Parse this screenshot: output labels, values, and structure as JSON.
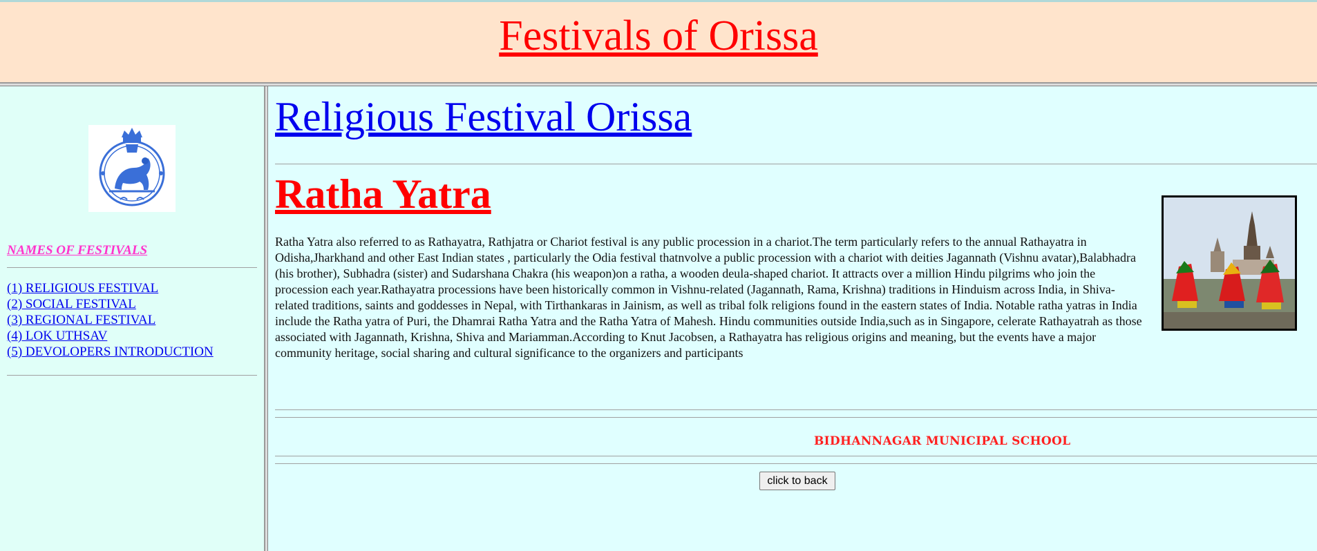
{
  "header": {
    "title": "Festivals of Orissa",
    "bg_color": "#ffe4cc",
    "title_color": "#ff0000"
  },
  "sidebar": {
    "emblem_icon": "odisha-state-emblem-icon",
    "heading": "NAMES OF FESTIVALS",
    "links": [
      {
        "label": "(1) RELIGIOUS FESTIVAL"
      },
      {
        "label": "(2) SOCIAL FESTIVAL"
      },
      {
        "label": "(3) REGIONAL FESTIVAL"
      },
      {
        "label": "(4) LOK UTHSAV"
      },
      {
        "label": "(5) DEVOLOPERS INTRODUCTION"
      }
    ],
    "heading_color": "#ff33cc",
    "link_color": "#0000ee"
  },
  "main": {
    "page_heading": "Religious Festival Orissa",
    "section_title": "Ratha Yatra",
    "body": "Ratha Yatra also referred to as Rathayatra, Rathjatra or Chariot festival is any public procession in a chariot.The term particularly refers to the annual Rathayatra in Odisha,Jharkhand and other East Indian states , particularly the Odia festival thatnvolve a public procession with a chariot with deities Jagannath (Vishnu avatar),Balabhadra (his brother), Subhadra (sister) and Sudarshana Chakra (his weapon)on a ratha, a wooden deula-shaped chariot. It attracts over a million Hindu pilgrims who join the procession each year.Rathayatra processions have been historically common in Vishnu-related (Jagannath, Rama, Krishna) traditions in Hinduism across India, in Shiva-related traditions, saints and goddesses in Nepal, with Tirthankaras in Jainism, as well as tribal folk religions found in the eastern states of India. Notable ratha yatras in India include the Ratha yatra of Puri, the Dhamrai Ratha Yatra and the Ratha Yatra of Mahesh. Hindu communities outside India,such as in Singapore, celerate Rathayatrah as those associated with Jagannath, Krishna, Shiva and Mariamman.According to Knut Jacobsen, a Rathayatra has religious origins and meaning, but the events have a major community heritage, social sharing and cultural significance to the organizers and participants",
    "photo_icon": "ratha-yatra-chariots-photo",
    "footer_school": "BIDHANNAGAR MUNICIPAL SCHOOL",
    "back_button": "click to back",
    "bg_color": "#e0ffff",
    "heading_color": "#0000ee",
    "section_color": "#ff0000"
  }
}
